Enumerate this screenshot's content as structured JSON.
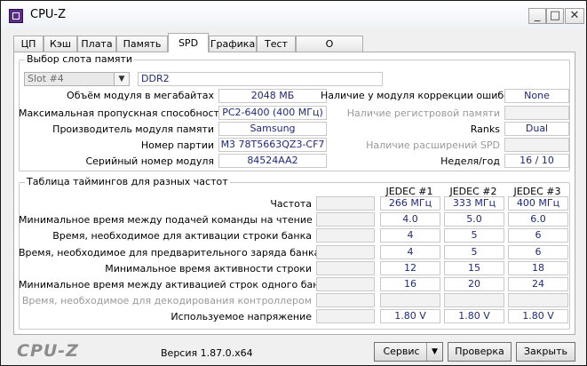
{
  "window": {
    "title": "CPU-Z",
    "min_glyph": "_",
    "max_glyph": "□",
    "close_glyph": "✕"
  },
  "tabs": [
    {
      "label": "ЦП"
    },
    {
      "label": "Кэш"
    },
    {
      "label": "Плата"
    },
    {
      "label": "Память"
    },
    {
      "label": "SPD"
    },
    {
      "label": "Графика"
    },
    {
      "label": "Тест"
    },
    {
      "label": "О программе"
    }
  ],
  "active_tab": "SPD",
  "slot": {
    "group_label": "Выбор слота памяти",
    "selected": "Slot #4",
    "type": "DDR2",
    "rows_left": [
      {
        "label": "Объём модуля в мегабайтах",
        "value": "2048 МБ"
      },
      {
        "label": "Максимальная пропускная способность",
        "value": "PC2-6400 (400 МГц)"
      },
      {
        "label": "Производитель модуля памяти",
        "value": "Samsung"
      },
      {
        "label": "Номер партии",
        "value": "M3 78T5663QZ3-CF7"
      },
      {
        "label": "Серийный номер модуля",
        "value": "84524AA2"
      }
    ],
    "rows_right": [
      {
        "label": "Наличие у модуля коррекции ошибок",
        "value": "None"
      },
      {
        "label": "Наличие регистровой памяти",
        "value": ""
      },
      {
        "label": "Ranks",
        "value": "Dual"
      },
      {
        "label": "Наличие расширений SPD",
        "value": ""
      },
      {
        "label": "Неделя/год",
        "value": "16 / 10"
      }
    ]
  },
  "timings": {
    "group_label": "Таблица таймингов для разных частот",
    "columns": [
      "JEDEC #1",
      "JEDEC #2",
      "JEDEC #3"
    ],
    "rows": [
      {
        "label": "Частота",
        "values": [
          "266 МГц",
          "333 МГц",
          "400 МГц"
        ]
      },
      {
        "label": "Минимальное время между подачей команды на чтение",
        "values": [
          "4.0",
          "5.0",
          "6.0"
        ]
      },
      {
        "label": "Время, необходимое для активации строки банка",
        "values": [
          "4",
          "5",
          "6"
        ]
      },
      {
        "label": "Время, необходимое для предварительного заряда банка",
        "values": [
          "4",
          "5",
          "6"
        ]
      },
      {
        "label": "Минимальное время активности строки",
        "values": [
          "12",
          "15",
          "18"
        ]
      },
      {
        "label": "Минимальное время между активацией строк одного банка",
        "values": [
          "16",
          "20",
          "24"
        ]
      },
      {
        "label": "Время, необходимое для декодирования контроллером",
        "values": [
          "",
          "",
          ""
        ]
      },
      {
        "label": "Используемое напряжение",
        "values": [
          "1.80 V",
          "1.80 V",
          "1.80 V"
        ]
      }
    ]
  },
  "footer": {
    "logo": "CPU-Z",
    "version": "Версия 1.87.0.x64",
    "service": "Сервис",
    "check": "Проверка",
    "close": "Закрыть"
  },
  "colors": {
    "value_text": "#1e2a7a",
    "disabled_text": "#9a9a9a"
  }
}
